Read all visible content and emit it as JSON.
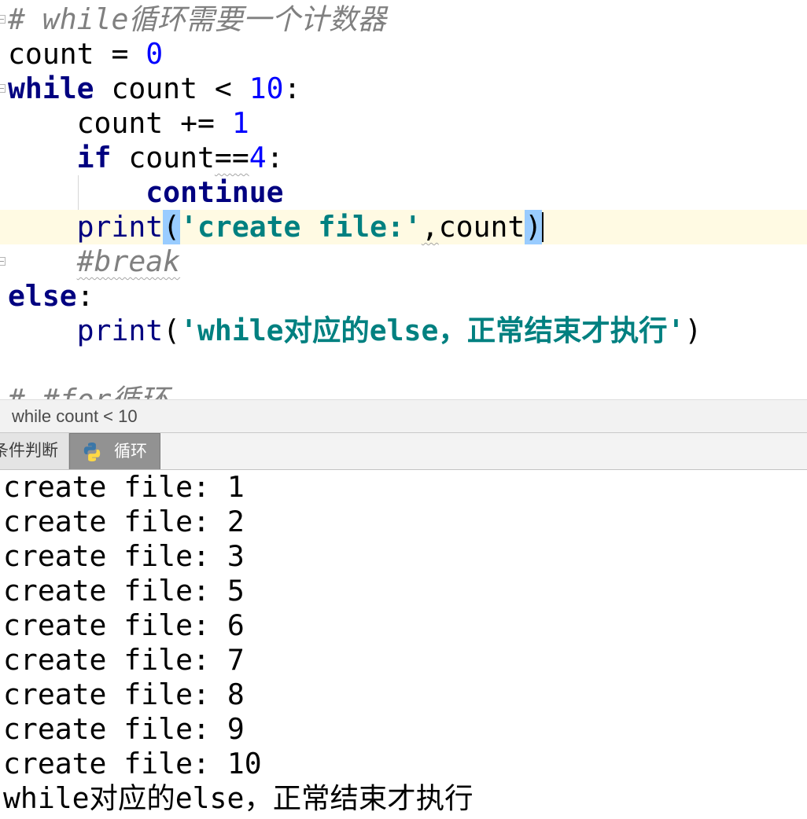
{
  "editor": {
    "lines": [
      [
        "# while循环需要一个计数器"
      ],
      [
        "count = ",
        "0"
      ],
      [
        "while",
        " count < ",
        "10",
        ":"
      ],
      [
        "count += ",
        "1"
      ],
      [
        "if",
        " count",
        "==",
        "4",
        ":"
      ],
      [
        "continue"
      ],
      [
        "print",
        "(",
        "'create file:'",
        ",",
        "count",
        ")"
      ],
      [
        "#break"
      ],
      [
        "else",
        ":"
      ],
      [
        "print",
        "(",
        "'while对应的else，正常结束才执行'",
        ")"
      ],
      [],
      [
        "# #for循环"
      ]
    ]
  },
  "breadcrumb": {
    "text": "while count < 10"
  },
  "run_tabs": [
    {
      "label": "条件判断",
      "active": false
    },
    {
      "label": "循环",
      "icon": "python-icon",
      "active": true
    }
  ],
  "console": {
    "lines": [
      "create file: 1",
      "create file: 2",
      "create file: 3",
      "create file: 5",
      "create file: 6",
      "create file: 7",
      "create file: 8",
      "create file: 9",
      "create file: 10",
      "while对应的else，正常结束才执行"
    ]
  },
  "colors": {
    "keyword": "#000080",
    "builtin": "#000080",
    "number": "#0000ff",
    "string": "#008080",
    "comment": "#808080",
    "current_line": "#fffae3",
    "brace_match": "#99ccff"
  }
}
